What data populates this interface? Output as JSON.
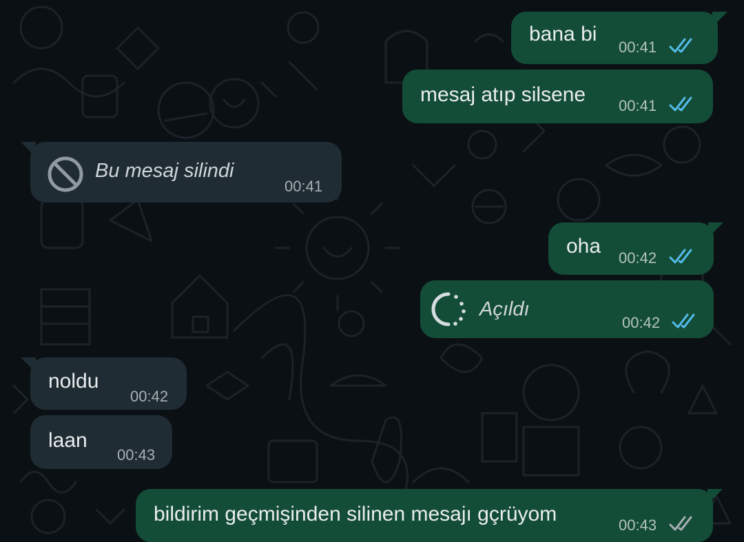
{
  "colors": {
    "background": "#0b1014",
    "outgoing_bubble": "#144d37",
    "incoming_bubble": "#202c33",
    "read_ticks": "#53bdeb",
    "delivered_ticks": "#a7b0b5"
  },
  "messages": [
    {
      "direction": "outgoing",
      "text": "bana bi",
      "time": "00:41",
      "status": "read"
    },
    {
      "direction": "outgoing",
      "text": "mesaj atıp silsene",
      "time": "00:41",
      "status": "read"
    },
    {
      "direction": "incoming",
      "text": "Bu mesaj silindi",
      "time": "00:41",
      "deleted": true,
      "icon": "deleted-icon"
    },
    {
      "direction": "outgoing",
      "text": "oha",
      "time": "00:42",
      "status": "read"
    },
    {
      "direction": "outgoing",
      "text": "Açıldı",
      "time": "00:42",
      "status": "read",
      "view_once": true,
      "icon": "view-once-opened-icon"
    },
    {
      "direction": "incoming",
      "text": "noldu",
      "time": "00:42"
    },
    {
      "direction": "incoming",
      "text": "laan",
      "time": "00:43"
    },
    {
      "direction": "outgoing",
      "text": "bildirim geçmişinden silinen mesajı gçrüyom",
      "time": "00:43",
      "status": "delivered"
    }
  ]
}
